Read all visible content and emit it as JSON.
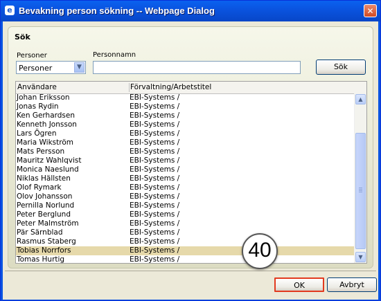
{
  "window": {
    "title": "Bevakning person sökning -- Webpage Dialog",
    "app_icon": "ie-icon",
    "close_label": "✕"
  },
  "search": {
    "heading": "Sök",
    "personer_label": "Personer",
    "personer_selected": "Personer",
    "personnamn_label": "Personnamn",
    "personnamn_value": "",
    "search_button": "Sök"
  },
  "grid": {
    "columns": [
      "Användare",
      "Förvaltning/Arbetstitel"
    ],
    "selected_index": 18,
    "rows": [
      {
        "user": "Johan Eriksson",
        "org": "EBI-Systems /"
      },
      {
        "user": "Jonas Rydin",
        "org": "EBI-Systems /"
      },
      {
        "user": "Ken Gerhardsen",
        "org": "EBI-Systems /"
      },
      {
        "user": "Kenneth Jonsson",
        "org": "EBI-Systems /"
      },
      {
        "user": "Lars Ögren",
        "org": "EBI-Systems /"
      },
      {
        "user": "Maria Wikström",
        "org": "EBI-Systems /"
      },
      {
        "user": "Mats Persson",
        "org": "EBI-Systems /"
      },
      {
        "user": "Mauritz Wahlqvist",
        "org": "EBI-Systems /"
      },
      {
        "user": "Monica Naeslund",
        "org": "EBI-Systems /"
      },
      {
        "user": "Niklas Hällsten",
        "org": "EBI-Systems /"
      },
      {
        "user": "Olof Rymark",
        "org": "EBI-Systems /"
      },
      {
        "user": "Olov Johansson",
        "org": "EBI-Systems /"
      },
      {
        "user": "Pernilla Norlund",
        "org": "EBI-Systems /"
      },
      {
        "user": "Peter Berglund",
        "org": "EBI-Systems /"
      },
      {
        "user": "Peter Malmström",
        "org": "EBI-Systems /"
      },
      {
        "user": "Pär Särnblad",
        "org": "EBI-Systems /"
      },
      {
        "user": "Rasmus Staberg",
        "org": "EBI-Systems /"
      },
      {
        "user": "Tobias Norrfors",
        "org": "EBI-Systems /"
      },
      {
        "user": "Tomas Hurtig",
        "org": "EBI-Systems /"
      }
    ]
  },
  "footer": {
    "ok_label": "OK",
    "cancel_label": "Avbryt"
  },
  "annotation": {
    "step_number": "40"
  },
  "colors": {
    "titlebar": "#0a54e0",
    "selected_row": "#e6d9aa",
    "ok_highlight": "#e23a1f"
  }
}
